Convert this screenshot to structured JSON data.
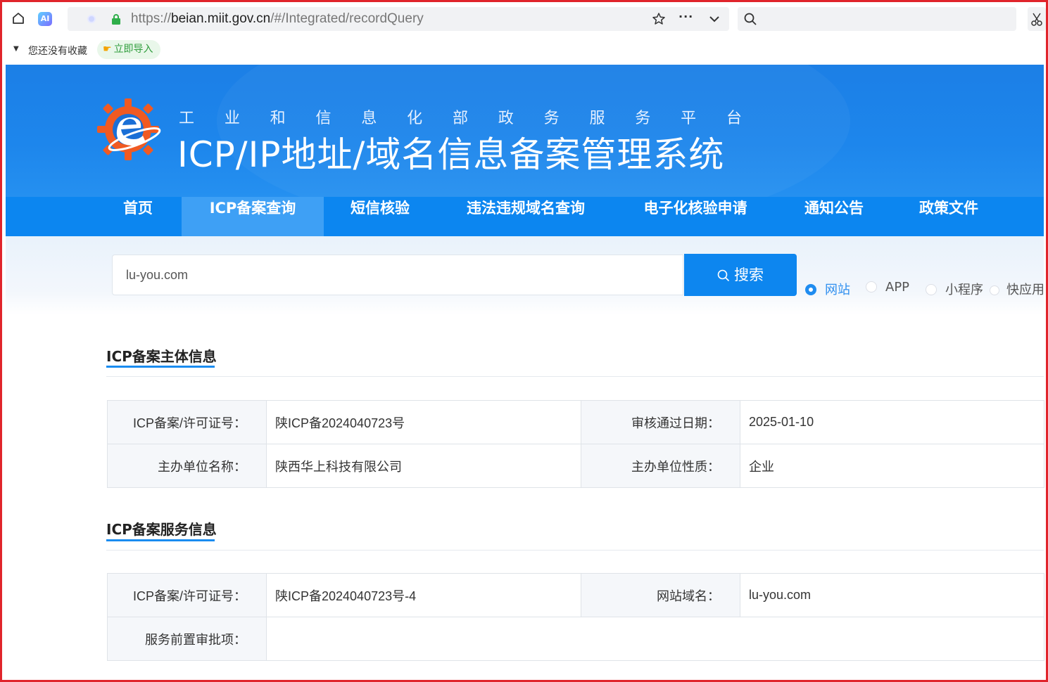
{
  "browser": {
    "url_prefix": "https://",
    "url_domain": "beian.miit.gov.cn",
    "url_path": "/#/Integrated/recordQuery",
    "ai_badge": "AI",
    "more": "···",
    "bookmarks_empty": "您还没有收藏",
    "bookmarks_import": "立即导入"
  },
  "header": {
    "subtitle_chars": [
      "工",
      "业",
      "和",
      "信",
      "息",
      "化",
      "部",
      "政",
      "务",
      "服",
      "务",
      "平",
      "台"
    ],
    "title": "ICP/IP地址/域名信息备案管理系统"
  },
  "nav": {
    "items": [
      {
        "label": "首页"
      },
      {
        "label": "ICP备案查询"
      },
      {
        "label": "短信核验"
      },
      {
        "label": "违法违规域名查询"
      },
      {
        "label": "电子化核验申请"
      },
      {
        "label": "通知公告"
      },
      {
        "label": "政策文件"
      }
    ],
    "active_index": 1
  },
  "search": {
    "value": "lu-you.com",
    "button_label": "搜索",
    "types": [
      {
        "label": "网站",
        "checked": true
      },
      {
        "label": "APP",
        "checked": false
      },
      {
        "label": "小程序",
        "checked": false
      },
      {
        "label": "快应用",
        "checked": false
      }
    ]
  },
  "subject_info": {
    "title": "ICP备案主体信息",
    "license_label": "ICP备案/许可证号：",
    "license_value": "陕ICP备2024040723号",
    "approve_date_label": "审核通过日期：",
    "approve_date_value": "2025-01-10",
    "org_name_label": "主办单位名称：",
    "org_name_value": "陕西华上科技有限公司",
    "org_type_label": "主办单位性质：",
    "org_type_value": "企业"
  },
  "service_info": {
    "title": "ICP备案服务信息",
    "license_label": "ICP备案/许可证号：",
    "license_value": "陕ICP备2024040723号-4",
    "domain_label": "网站域名：",
    "domain_value": "lu-you.com",
    "preapproval_label": "服务前置审批项：",
    "preapproval_value": ""
  },
  "colors": {
    "brand_blue": "#0c86f0",
    "nav_active": "#3ea0f5",
    "frame_red": "#e0242b"
  }
}
